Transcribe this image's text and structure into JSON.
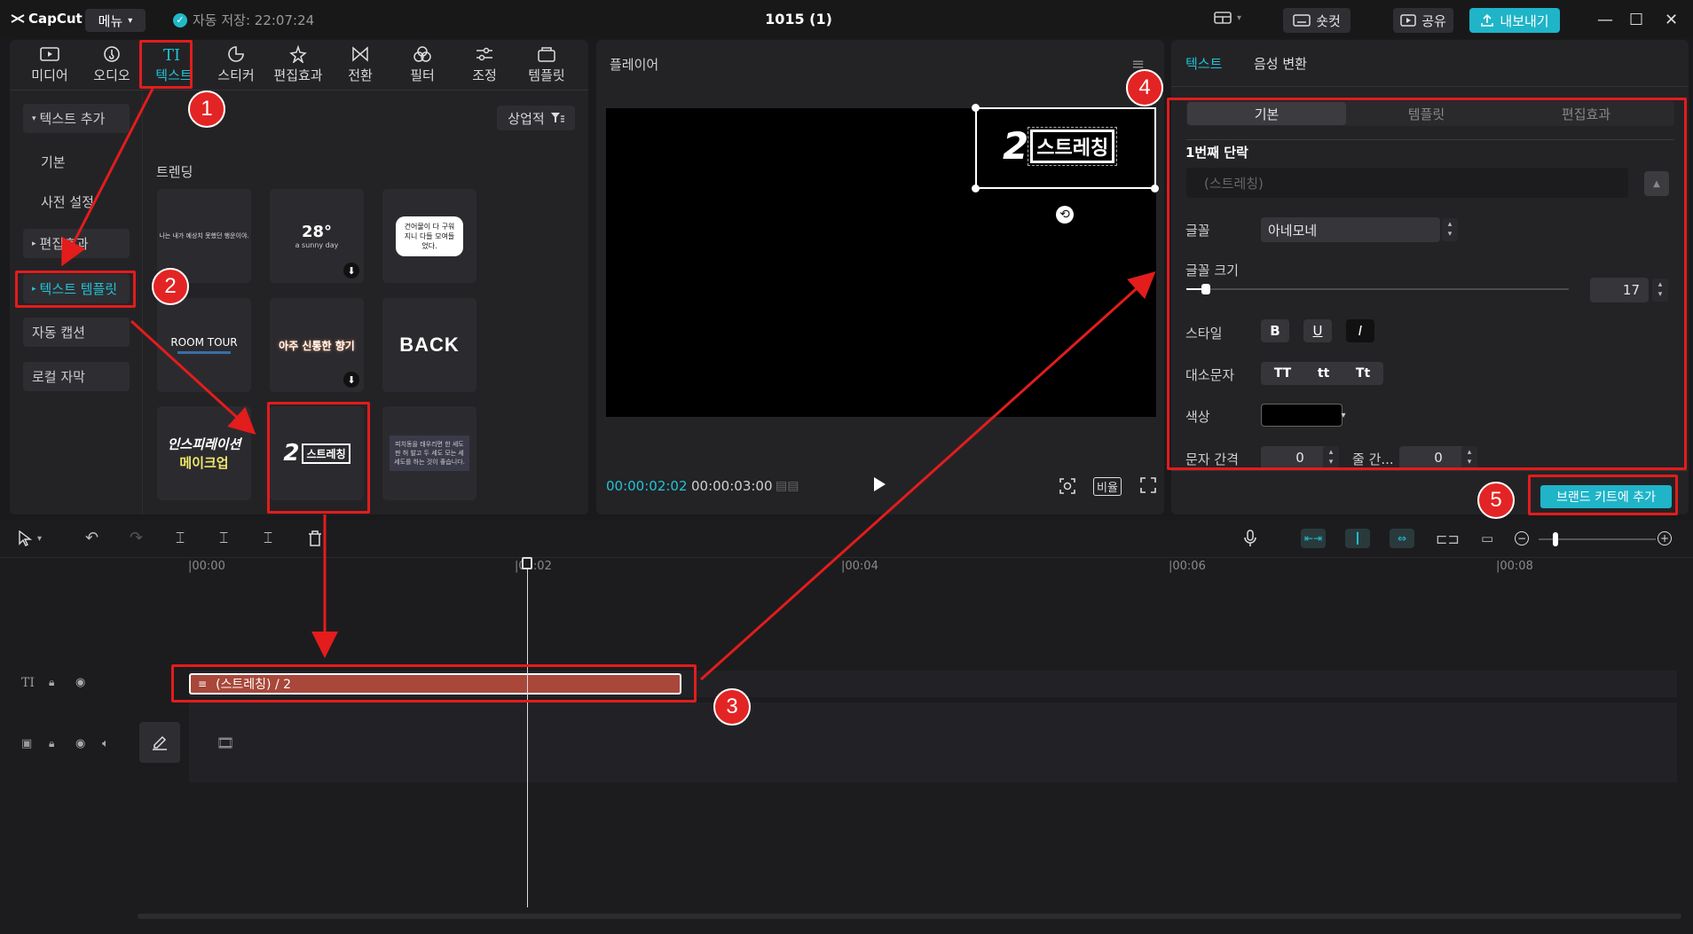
{
  "app": {
    "logo": "CapCut",
    "menu_label": "메뉴",
    "autosave": "자동 저장: 22:07:24",
    "project_title": "1015 (1)",
    "shortcut_label": "숏컷",
    "share_label": "공유",
    "export_label": "내보내기"
  },
  "toolbar_tabs": [
    {
      "label": "미디어",
      "icon": "media-icon"
    },
    {
      "label": "오디오",
      "icon": "audio-icon"
    },
    {
      "label": "텍스트",
      "icon": "text-icon",
      "active": true
    },
    {
      "label": "스티커",
      "icon": "sticker-icon"
    },
    {
      "label": "편집효과",
      "icon": "effects-icon"
    },
    {
      "label": "전환",
      "icon": "transition-icon"
    },
    {
      "label": "필터",
      "icon": "filter-icon"
    },
    {
      "label": "조정",
      "icon": "adjust-icon"
    },
    {
      "label": "템플릿",
      "icon": "template-icon"
    }
  ],
  "sidebar": {
    "items": [
      "텍스트 추가",
      "기본",
      "사전 설정",
      "편집효과",
      "텍스트 템플릿",
      "자동 캡션",
      "로컬 자막"
    ]
  },
  "library": {
    "filter_label": "상업적",
    "section": "트렌딩",
    "thumbs": {
      "t1": "나는 내가 예상치 못했던 행운이야.",
      "t2_temp": "28°",
      "t2_sub": "a sunny day",
      "t3": "건어물이 다 구워지니 다들 모여들었다.",
      "t4": "ROOM TOUR",
      "t5": "아주 신통한 향기",
      "t6": "BACK",
      "t7a": "인스피레이션",
      "t7b": "메이크업",
      "t8a": "2",
      "t8b": "스트레칭",
      "t9": "피치동을 태우리면 한 세도판 허 발고 두 세도 모는 세 세도를 하는 것이 좋습니다."
    }
  },
  "player": {
    "title": "플레이어",
    "overlay_num": "2",
    "overlay_text": "스트레칭",
    "time_current": "00:00:02:02",
    "time_total": "00:00:03:00",
    "ratio_label": "비율"
  },
  "properties": {
    "tabs": [
      "텍스트",
      "음성 변환"
    ],
    "subtabs": [
      "기본",
      "템플릿",
      "편집효과"
    ],
    "paragraph_title": "1번째 단락",
    "text_placeholder": "(스트레칭)",
    "font_label": "글꼴",
    "font_value": "아네모네",
    "font_size_label": "글꼴 크기",
    "font_size_value": "17",
    "font_size_slider_fraction": 0.05,
    "style_label": "스타일",
    "style_buttons": [
      "B",
      "U",
      "I"
    ],
    "case_label": "대소문자",
    "case_buttons": [
      "TT",
      "tt",
      "Tt"
    ],
    "color_label": "색상",
    "spacing_label": "문자 간격",
    "spacing_value": "0",
    "line_label": "줄 간...",
    "line_value": "0",
    "brand_kit_label": "브랜드 키트에 추가"
  },
  "timeline": {
    "ticks": [
      "|00:00",
      "|00:02",
      "|00:04",
      "|00:06",
      "|00:08"
    ],
    "clip_label": "(스트레칭)  / 2"
  },
  "annotations": [
    "1",
    "2",
    "3",
    "4",
    "5"
  ],
  "colors": {
    "accent": "#22c3d6",
    "annotation": "#e31c1c",
    "clip": "#a8473a"
  }
}
